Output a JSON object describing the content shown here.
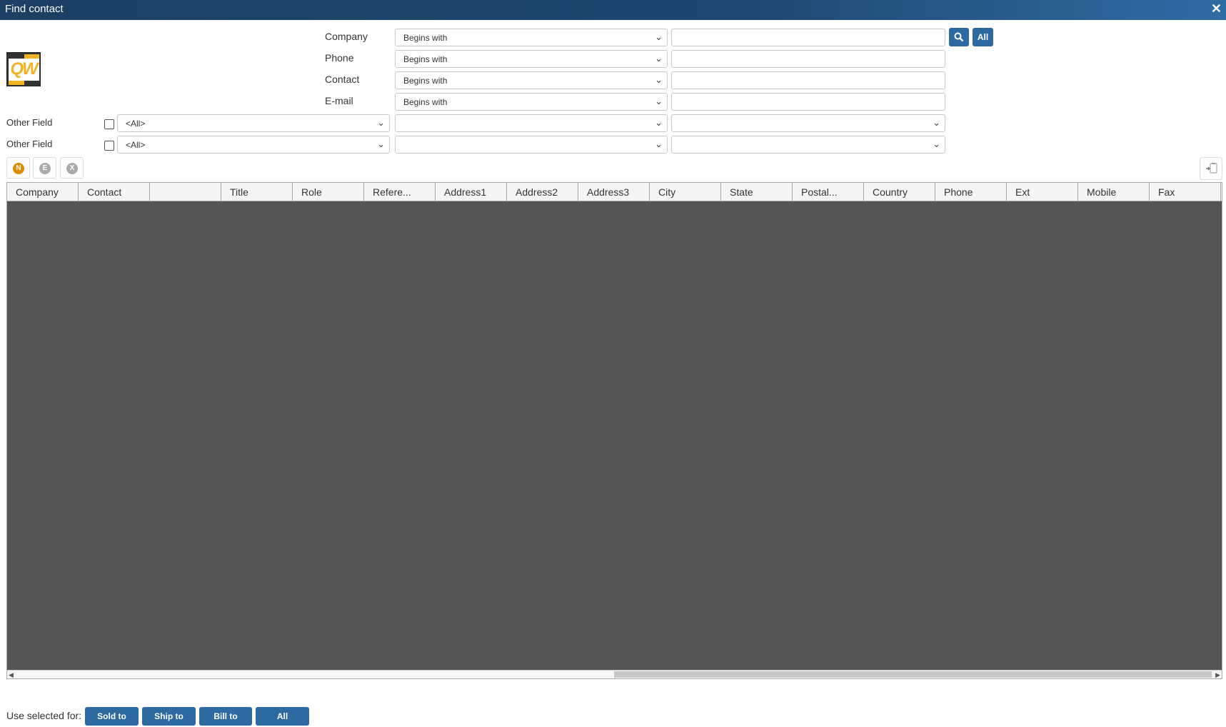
{
  "window": {
    "title": "Find contact",
    "close_icon": "close-icon"
  },
  "logo": {
    "text": "QW"
  },
  "search": {
    "rows": [
      {
        "label": "Company",
        "operator": "Begins with",
        "value": ""
      },
      {
        "label": "Phone",
        "operator": "Begins with",
        "value": ""
      },
      {
        "label": "Contact",
        "operator": "Begins with",
        "value": ""
      },
      {
        "label": "E-mail",
        "operator": "Begins with",
        "value": ""
      }
    ],
    "search_icon": "search-icon",
    "all_label": "All"
  },
  "other_fields": [
    {
      "label": "Other Field",
      "checked": false,
      "field": "<All>",
      "operator": "",
      "value": ""
    },
    {
      "label": "Other Field",
      "checked": false,
      "field": "<All>",
      "operator": "",
      "value": ""
    }
  ],
  "toolbar": {
    "new": "N",
    "edit": "E",
    "delete": "X"
  },
  "grid": {
    "columns": [
      "Company",
      "Contact",
      "",
      "Title",
      "Role",
      "Refere...",
      "Address1",
      "Address2",
      "Address3",
      "City",
      "State",
      "Postal...",
      "Country",
      "Phone",
      "Ext",
      "Mobile",
      "Fax"
    ],
    "rows": []
  },
  "footer": {
    "label": "Use selected for:",
    "buttons": [
      "Sold to",
      "Ship to",
      "Bill to",
      "All"
    ]
  },
  "colors": {
    "accent": "#2d6aa1",
    "titlebar": "#1c3f63",
    "grid_bg": "#555555",
    "logo_yellow": "#f0b323"
  }
}
